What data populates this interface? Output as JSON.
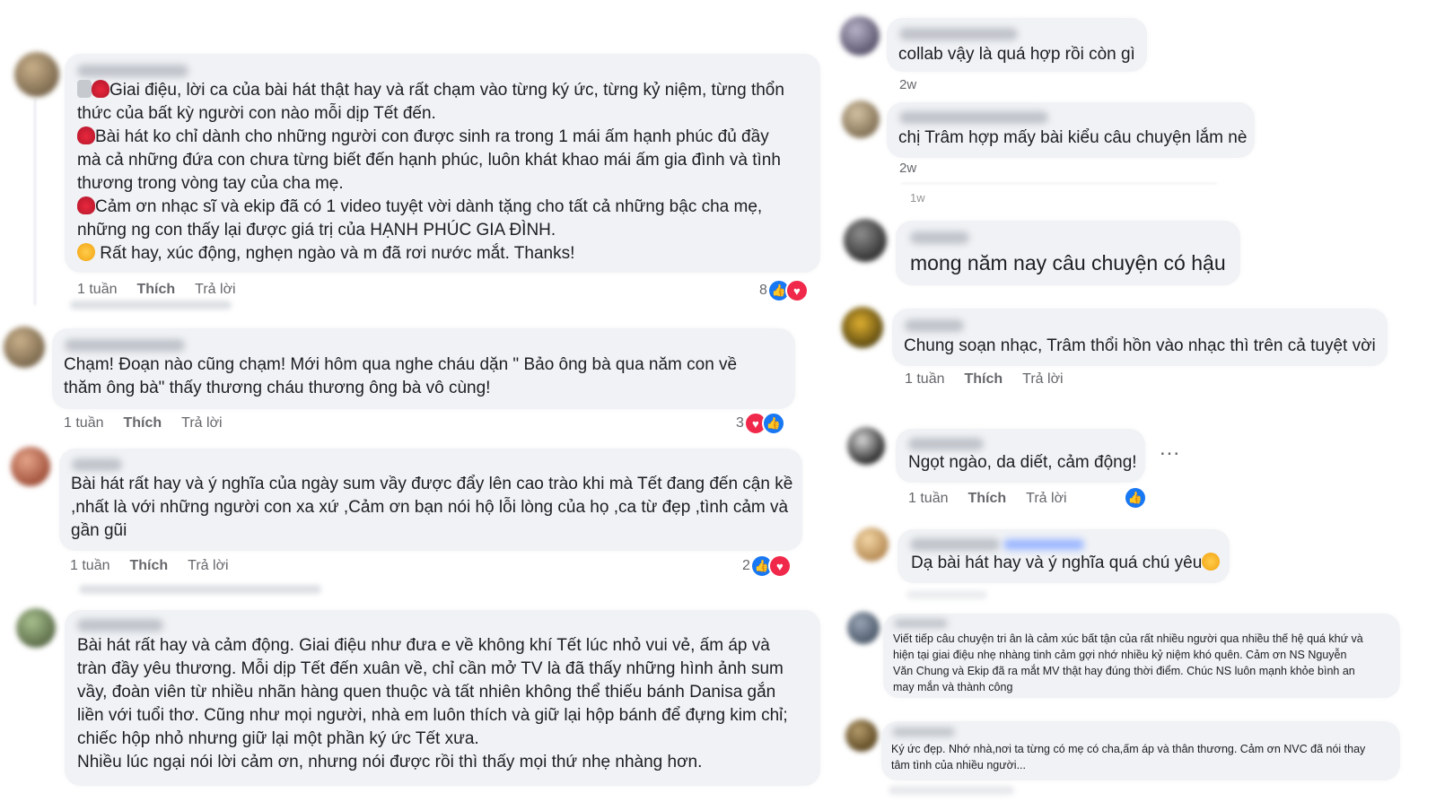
{
  "left": [
    {
      "text": "{note}{heart}Giai điệu, lời ca của bài hát thật hay và rất chạm vào từng ký ức, từng kỷ niệm, từng thổn\nthức của bất kỳ người con nào mỗi dịp Tết đến.\n{heart}Bài hát ko chỉ dành cho những người con được sinh ra trong 1 mái ấm hạnh phúc đủ đầy\nmà cả những đứa con chưa từng biết đến hạnh phúc, luôn khát khao mái ấm gia đình và tình\nthương trong vòng tay của cha mẹ.\n{heart}Cảm ơn nhạc sĩ và ekip đã có 1 video tuyệt vời dành tặng cho tất cả những bậc cha mẹ,\nnhững ng con thấy lại được giá trị của HẠNH PHÚC GIA ĐÌNH.\n{smile} Rất hay, xúc động, nghẹn ngào và m đã rơi nước mắt. Thanks!",
      "time": "1 tuần",
      "like": "Thích",
      "reply": "Trả lời",
      "count": "8"
    },
    {
      "text": "Chạm! Đoạn nào cũng chạm! Mới hôm qua nghe cháu dặn \" Bảo ông bà qua năm con về\nthăm ông bà\" thấy thương cháu thương ông bà vô cùng!",
      "time": "1 tuần",
      "like": "Thích",
      "reply": "Trả lời",
      "count": "3"
    },
    {
      "text": "Bài hát rất hay và ý nghĩa của ngày sum vầy được đẩy lên cao trào khi mà Tết đang đến cận kề\n,nhất là với những người con xa xứ ,Cảm ơn bạn nói hộ lỗi lòng của họ ,ca từ đẹp ,tình cảm và\ngần gũi",
      "time": "1 tuần",
      "like": "Thích",
      "reply": "Trả lời",
      "count": "2"
    },
    {
      "text": "Bài hát rất hay và cảm động. Giai điệu như đưa e về không khí Tết lúc nhỏ vui vẻ, ấm áp và\ntràn đầy yêu thương. Mỗi dịp Tết đến xuân về, chỉ cần mở TV là đã thấy những hình ảnh sum\nvầy, đoàn viên từ nhiều nhãn hàng quen thuộc và tất nhiên không thể thiếu bánh Danisa gắn\nliền với tuổi thơ. Cũng như mọi người, nhà em luôn thích và giữ lại hộp bánh để đựng kim chỉ;\nchiếc hộp nhỏ nhưng giữ lại một phần ký ức Tết xưa.\nNhiều lúc ngại nói lời cảm ơn, nhưng nói được rồi thì thấy mọi thứ nhẹ nhàng hơn."
    }
  ],
  "right": [
    {
      "text": "collab vậy là quá hợp rồi còn gì",
      "time": "2w"
    },
    {
      "text": "chị Trâm hợp mấy bài kiểu câu chuyện lắm nè",
      "time": "2w"
    },
    {
      "text": "mong năm nay câu chuyện có hậu",
      "time_above": "1w"
    },
    {
      "text": "Chung soạn nhạc, Trâm thổi hồn vào nhạc thì trên cả tuyệt vời",
      "time": "1 tuần",
      "like": "Thích",
      "reply": "Trả lời"
    },
    {
      "text": "Ngọt ngào, da diết, cảm động!",
      "time": "1 tuần",
      "like": "Thích",
      "reply": "Trả lời",
      "more": "..."
    },
    {
      "text": "Dạ bài hát hay và ý nghĩa quá chú yêu{smile}"
    },
    {
      "text": "Viết tiếp câu chuyện tri ân là cảm xúc bất tận của rất nhiều người qua nhiều thế hệ quá khứ và\nhiện tại giai điệu nhẹ nhàng tinh cảm gợi nhớ nhiều kỷ niệm khó quên. Cảm ơn NS Nguyễn\nVăn Chung và Ekip đã ra mắt MV thật hay đúng thời điểm. Chúc NS luôn mạnh khỏe bình an\nmay mắn và thành công"
    },
    {
      "text": "Ký ức đẹp. Nhớ nhà,nơi ta từng có mẹ có cha,ấm áp và thân thương. Cảm ơn NVC đã nói thay\ntâm tình của nhiều người..."
    }
  ],
  "icons": {
    "like": "like-icon",
    "love": "love-icon",
    "heart_emoji": "heart-emoji-icon",
    "smile_emoji": "heart-eyes-emoji-icon",
    "note_emoji": "music-note-emoji-icon"
  },
  "colors": {
    "bubble": "#f0f2f5",
    "like": "#1877f2",
    "love": "#f0284a",
    "meta": "#65676b"
  }
}
